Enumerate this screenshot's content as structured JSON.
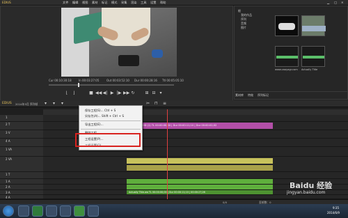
{
  "titlebar": {
    "app_name": "EDIUS",
    "menu": [
      "文件",
      "编辑",
      "视图",
      "素材",
      "标记",
      "模式",
      "采集",
      "渲染",
      "工具",
      "设置",
      "帮助"
    ]
  },
  "player": {
    "timecodes": {
      "cur": "Cur 00:10:30:18",
      "in": "In 00:03:27:05",
      "out": "Out 00:03:52:10",
      "dur": "Dur 00:00:28:16",
      "ttl": "Ttl 00:05:05:10"
    }
  },
  "bin": {
    "tree": [
      "根",
      "我的作品",
      "序列",
      "音频",
      "图片"
    ],
    "thumbs": [
      {
        "label": ""
      },
      {
        "label": ""
      },
      {
        "label": "www.vooyagr.com"
      },
      {
        "label": "Actually Title"
      }
    ],
    "tabs": [
      "素材库",
      "特效",
      "序列标记"
    ]
  },
  "timeline": {
    "title": "EDIUS",
    "project": "2014年5月 序列帧",
    "tracks": [
      "1",
      "2 T",
      "3 V",
      "4 A",
      "1 VA",
      "2 VA",
      "1 T",
      "1 A",
      "2 A",
      "3 A",
      "4 A"
    ],
    "clip_labels": {
      "pink": "HD (1) TL 00:00:00;00 | Dur 00:00:11;10 | Dur 00:00:02;02",
      "green": "Actually Title.wa  TL 00:00:00;00 | Dur 00:00:11;10 | 00:00:27;26"
    }
  },
  "context_menu": {
    "items": [
      "保存工程(S)...   Ctrl + S",
      "另存为(A)...   Shift + Ctrl + S",
      "导出工程(E)...",
      "删除工程",
      "工程设置(P)...",
      "工程设置(O)..."
    ],
    "highlighted_index": 4
  },
  "status": {
    "left": "0/0",
    "right": "丢帧数：0"
  },
  "taskbar": {
    "time": "9:35",
    "date": "2014/6/9"
  },
  "watermark": {
    "brand": "Baidu 经验",
    "url": "jingyan.baidu.com"
  }
}
